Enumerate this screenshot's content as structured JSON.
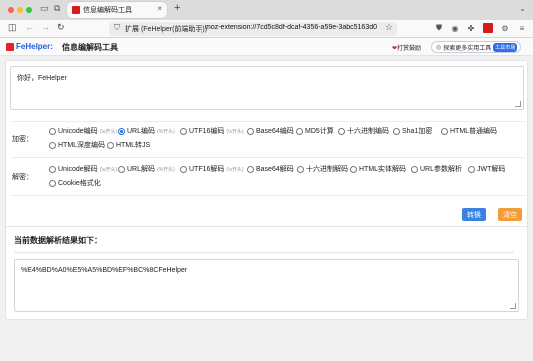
{
  "browser": {
    "tab_title": "信息编解码工具",
    "url_ext_label": "扩展 (FeHelper(前端助手))",
    "url": "moz-extension://7cd5c8df-dcaf-4356-a59e-3abc5163d0ba/e",
    "new_tab": "+",
    "tab_close": "×"
  },
  "app": {
    "brand": "FeHelper:",
    "title": "信息编解码工具",
    "donate": "打赏鼓励",
    "more_tools": "探索更多实用工具",
    "tool_market": "工具市场"
  },
  "input": {
    "value": "你好，FeHelper"
  },
  "encode": {
    "label": "加密：",
    "options": [
      {
        "label": "Unicode编码",
        "hint": "(\\u开头)",
        "selected": false
      },
      {
        "label": "URL编码",
        "hint": "(%开头)",
        "selected": true
      },
      {
        "label": "UTF16编码",
        "hint": "(\\x开头)",
        "selected": false
      },
      {
        "label": "Base64编码",
        "hint": "",
        "selected": false
      },
      {
        "label": "MD5计算",
        "hint": "",
        "selected": false
      },
      {
        "label": "十六进制编码",
        "hint": "",
        "selected": false
      },
      {
        "label": "Sha1加密",
        "hint": "",
        "selected": false
      },
      {
        "label": "HTML普通编码",
        "hint": "",
        "selected": false
      },
      {
        "label": "HTML深度编码",
        "hint": "",
        "selected": false
      },
      {
        "label": "HTML转JS",
        "hint": "",
        "selected": false
      }
    ]
  },
  "decode": {
    "label": "解密：",
    "options": [
      {
        "label": "Unicode解码",
        "hint": "(\\u开头)",
        "selected": false
      },
      {
        "label": "URL解码",
        "hint": "(%开头)",
        "selected": false
      },
      {
        "label": "UTF16解码",
        "hint": "(\\x开头)",
        "selected": false
      },
      {
        "label": "Base64解码",
        "hint": "",
        "selected": false
      },
      {
        "label": "十六进制解码",
        "hint": "",
        "selected": false
      },
      {
        "label": "HTML实体解码",
        "hint": "",
        "selected": false
      },
      {
        "label": "URL参数解析",
        "hint": "",
        "selected": false
      },
      {
        "label": "JWT解码",
        "hint": "",
        "selected": false
      },
      {
        "label": "Cookie格式化",
        "hint": "",
        "selected": false
      }
    ]
  },
  "actions": {
    "convert": "转换",
    "clear": "清空"
  },
  "result": {
    "title": "当前数据解析结果如下：",
    "value": "%E4%BD%A0%E5%A5%BD%EF%BC%8CFeHelper"
  },
  "colors": {
    "accent": "#3a82e0",
    "clear_button": "#f39c38",
    "brand": "#1e5fd6",
    "logo": "#e02323"
  }
}
